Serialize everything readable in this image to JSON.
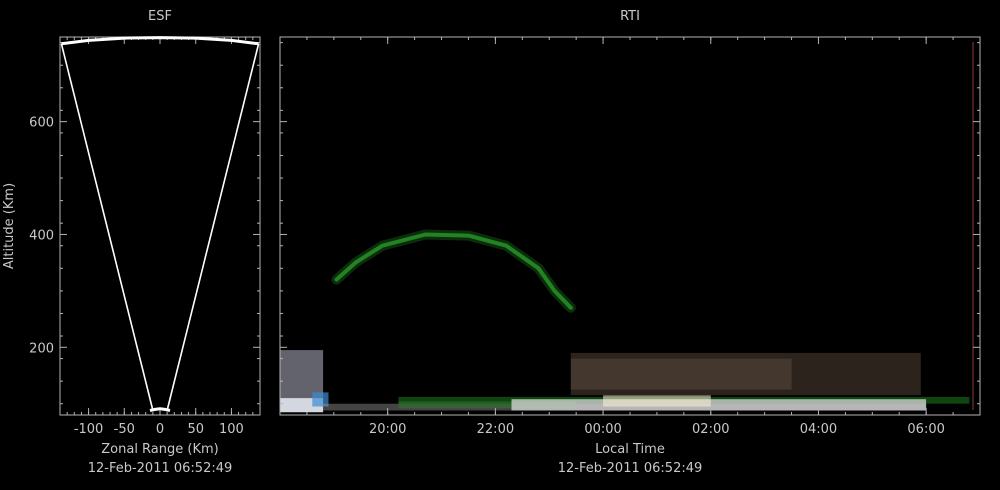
{
  "chart_data": [
    {
      "type": "line",
      "title": "ESF",
      "xlabel": "Zonal Range (Km)",
      "ylabel": "Altitude (Km)",
      "timestamp": "12-Feb-2011 06:52:49",
      "xlim": [
        -140,
        140
      ],
      "ylim": [
        80,
        750
      ],
      "x_ticks": [
        -100,
        -50,
        0,
        50,
        100
      ],
      "y_ticks": [
        200,
        400,
        600
      ],
      "series": [
        {
          "x": [
            -10,
            -138
          ],
          "y": [
            88,
            738
          ]
        },
        {
          "x": [
            10,
            138
          ],
          "y": [
            88,
            738
          ]
        },
        {
          "x": [
            -138,
            -100,
            -50,
            0,
            50,
            100,
            138
          ],
          "y": [
            738,
            744,
            748,
            749,
            748,
            744,
            738
          ]
        },
        {
          "x": [
            -14,
            -7,
            0,
            7,
            14
          ],
          "y": [
            88,
            90,
            91,
            90,
            88
          ]
        }
      ]
    },
    {
      "type": "heatmap",
      "title": "RTI",
      "xlabel": "Local Time",
      "timestamp": "12-Feb-2011 06:52:49",
      "xlim": [
        18.0,
        31.0
      ],
      "ylim": [
        80,
        750
      ],
      "x_tick_values": [
        20,
        22,
        24,
        26,
        28,
        30
      ],
      "x_tick_labels": [
        "20:00",
        "22:00",
        "00:00",
        "02:00",
        "04:00",
        "06:00"
      ],
      "y_ticks": [
        200,
        400,
        600
      ],
      "echoes": [
        {
          "t0": 18.0,
          "t1": 18.8,
          "alt0": 85,
          "alt1": 195,
          "color": "#b4b4c8",
          "opacity": 0.55
        },
        {
          "t0": 18.0,
          "t1": 18.8,
          "alt0": 85,
          "alt1": 110,
          "color": "#e6ecf5",
          "opacity": 0.85
        },
        {
          "t0": 18.6,
          "t1": 18.9,
          "alt0": 95,
          "alt1": 120,
          "color": "#3c8cd2",
          "opacity": 0.7
        },
        {
          "t0": 18.8,
          "t1": 30.0,
          "alt0": 88,
          "alt1": 100,
          "color": "#969696",
          "opacity": 0.45
        },
        {
          "t0": 20.2,
          "t1": 30.8,
          "alt0": 100,
          "alt1": 112,
          "color": "#1e8c1e",
          "opacity": 0.5
        },
        {
          "t0": 20.2,
          "t1": 23.5,
          "alt0": 92,
          "alt1": 104,
          "color": "#2e7a2e",
          "opacity": 0.55
        },
        {
          "t0": 22.3,
          "t1": 30.0,
          "alt0": 88,
          "alt1": 108,
          "color": "#dcdcdc",
          "opacity": 0.75
        },
        {
          "t0": 24.0,
          "t1": 26.0,
          "alt0": 95,
          "alt1": 115,
          "color": "#fff0d7",
          "opacity": 0.55
        },
        {
          "t0": 23.4,
          "t1": 29.9,
          "alt0": 115,
          "alt1": 190,
          "color": "#7d6450",
          "opacity": 0.35
        },
        {
          "t0": 23.4,
          "t1": 27.5,
          "alt0": 125,
          "alt1": 180,
          "color": "#8c7864",
          "opacity": 0.25
        }
      ],
      "plume": {
        "path": [
          [
            19.05,
            320
          ],
          [
            19.4,
            350
          ],
          [
            19.9,
            380
          ],
          [
            20.7,
            400
          ],
          [
            21.5,
            398
          ],
          [
            22.2,
            380
          ],
          [
            22.8,
            340
          ],
          [
            23.1,
            300
          ],
          [
            23.4,
            270
          ]
        ],
        "color": "#2aa02a"
      }
    }
  ]
}
